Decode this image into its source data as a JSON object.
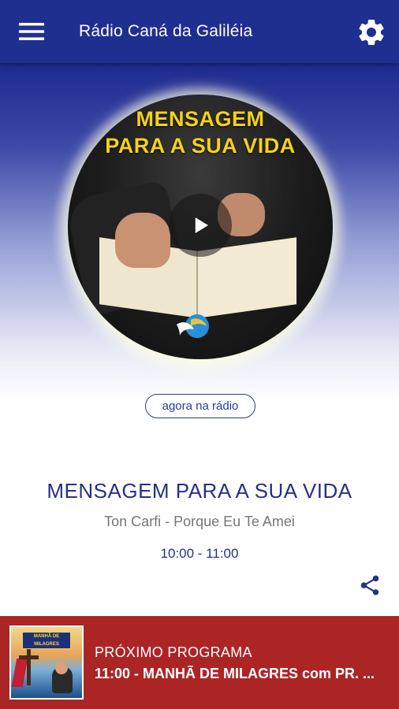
{
  "app": {
    "title": "Rádio Caná da Galiléia",
    "menu_icon": "hamburger-menu-icon",
    "settings_icon": "gear-icon",
    "bar_color": "#1f2f8f"
  },
  "cover": {
    "headline_line1": "MENSAGEM",
    "headline_line2": "PARA A SUA VIDA",
    "headline_color": "#f5d21a",
    "play_icon": "play-icon"
  },
  "now_playing": {
    "badge": "agora na rádio",
    "program_title": "MENSAGEM PARA A SUA VIDA",
    "song": "Ton Carfi - Porque Eu Te Amei",
    "time": "10:00 - 11:00",
    "share_icon": "share-icon",
    "accent_color": "#27308a"
  },
  "next_program": {
    "label": "PRÓXIMO PROGRAMA",
    "show": "11:00 - MANHÃ DE MILAGRES com PR. ...",
    "thumb_title": "MANHÃ DE MILAGRES",
    "bar_color": "#ab2525"
  }
}
